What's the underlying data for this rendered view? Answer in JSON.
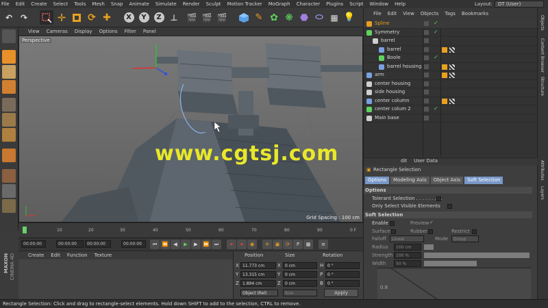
{
  "menubar": {
    "items": [
      "File",
      "Edit",
      "Create",
      "Select",
      "Tools",
      "Mesh",
      "Snap",
      "Animate",
      "Simulate",
      "Render",
      "Sculpt",
      "Motion Tracker",
      "MoGraph",
      "Character",
      "Plugins",
      "Script",
      "Window",
      "Help"
    ],
    "layout_label": "Layout:",
    "layout_value": "DT (User)"
  },
  "toolbar": {
    "axis_x": "X",
    "axis_y": "Y",
    "axis_z": "Z"
  },
  "viewport": {
    "menu": [
      "View",
      "Cameras",
      "Display",
      "Options",
      "Filter",
      "Panel"
    ],
    "label": "Perspective",
    "grid_spacing": "Grid Spacing : 100 cm",
    "watermark": "www.cgtsj.com"
  },
  "timeline": {
    "ticks": [
      "0",
      "10",
      "20",
      "30",
      "40",
      "50",
      "60",
      "70",
      "80",
      "90"
    ],
    "frame_end": "0 F",
    "start_field": "00:00:00",
    "current_field": "00:00:00",
    "end_field": "00:00:00",
    "end_field2": "00:00:00"
  },
  "material": {
    "menu": [
      "Create",
      "Edit",
      "Function",
      "Texture"
    ]
  },
  "coords": {
    "headers": [
      "Position",
      "Size",
      "Rotation"
    ],
    "rows": [
      {
        "axis": "X",
        "pos": "11.773 cm",
        "size_axis": "X",
        "size": "0 cm",
        "rot_axis": "H",
        "rot": "0 °"
      },
      {
        "axis": "Y",
        "pos": "13.315 cm",
        "size_axis": "Y",
        "size": "0 cm",
        "rot_axis": "P",
        "rot": "0 °"
      },
      {
        "axis": "Z",
        "pos": "1.894 cm",
        "size_axis": "Z",
        "size": "0 cm",
        "rot_axis": "B",
        "rot": "0 °"
      }
    ],
    "mode": "Object (Rel)",
    "size_mode": "Size",
    "apply": "Apply"
  },
  "objects": {
    "menu": [
      "File",
      "Edit",
      "View",
      "Objects",
      "Tags",
      "Bookmarks"
    ],
    "items": [
      {
        "name": "Spline",
        "indent": 0,
        "color": "#e8a020",
        "highlight": true
      },
      {
        "name": "Symmetry",
        "indent": 0,
        "color": "#5fd35f"
      },
      {
        "name": "barrel",
        "indent": 1,
        "color": "#cfcfcf"
      },
      {
        "name": "barrel",
        "indent": 2,
        "color": "#7aa0e0"
      },
      {
        "name": "Boole",
        "indent": 2,
        "color": "#5fd35f"
      },
      {
        "name": "barrel housing",
        "indent": 2,
        "color": "#7aa0e0"
      },
      {
        "name": "arm",
        "indent": 0,
        "color": "#7aa0e0"
      },
      {
        "name": "center housing",
        "indent": 0,
        "color": "#cfcfcf"
      },
      {
        "name": "side housing",
        "indent": 0,
        "color": "#cfcfcf"
      },
      {
        "name": "center column",
        "indent": 0,
        "color": "#7aa0e0"
      },
      {
        "name": "center colum 2",
        "indent": 0,
        "color": "#5fd35f"
      },
      {
        "name": "Main base",
        "indent": 0,
        "color": "#cfcfcf"
      }
    ]
  },
  "attributes": {
    "menu": [
      "dit",
      "User Data"
    ],
    "title": "Rectangle Selection",
    "tabs": [
      "Options",
      "Modeling Axis",
      "Object Axis",
      "Soft Selection"
    ],
    "options_header": "Options",
    "tolerant": "Tolerant Selection . . . . . . . . .",
    "only_visible": "Only Select Visible Elements",
    "soft_header": "Soft Selection",
    "enable": "Enable",
    "preview": "Preview",
    "surface": "Surface",
    "rubber": "Rubber",
    "restrict": "Restrict",
    "falloff": "Falloff",
    "falloff_value": "Linear",
    "mode": "Mode",
    "mode_value": "Group",
    "radius": "Radius",
    "radius_value": "100 cm",
    "strength": "Strength",
    "strength_value": "100 %",
    "width": "Width",
    "width_value": "50 %",
    "graph_label": "0.8"
  },
  "sidebar_tabs": [
    "Objects",
    "Content Browser",
    "Structure",
    "Attributes",
    "Layers"
  ],
  "status": "Rectangle Selection: Click and drag to rectangle-select elements. Hold down SHIFT to add to the selection, CTRL to remove.",
  "brand": {
    "top": "MAXON",
    "bottom": "CINEMA 4D"
  }
}
